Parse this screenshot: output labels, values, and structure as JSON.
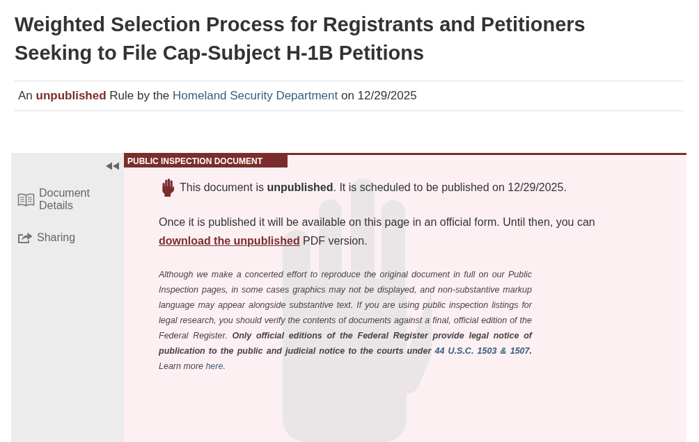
{
  "title": "Weighted Selection Process for Registrants and Petitioners Seeking to File Cap-Subject H-1B Petitions",
  "byline": {
    "before": "An **unpublished** Rule by the",
    "agency": "Homeland Security Department",
    "after": "on 12/29/2025"
  },
  "sidebar": {
    "items": [
      {
        "label": "Document Details"
      },
      {
        "label": "Sharing"
      }
    ]
  },
  "document": {
    "tab": "PUBLIC INSPECTION DOCUMENT",
    "notice": "This document is **unpublished**. It is scheduled to be published on 12/29/2025.",
    "availability": {
      "before": "Once it is published it will be available on this page in an official form. Until then, you can",
      "link": "download the unpublished",
      "after": "PDF version."
    },
    "disclaimer": [
      {
        "kind": "text",
        "text": "Although we make a concerted effort to reproduce the original document in full on our Public Inspection pages, in some cases graphics may not be displayed, and non-substantive markup language may appear alongside substantive text. If you are using public inspection listings for legal research, you should verify the contents of documents against a final, official edition of the Federal Register. **Only official editions of the Federal Register provide legal notice of publication to the public and judicial notice to the courts under** "
      },
      {
        "kind": "strong_link",
        "text": "44 U.S.C. 1503 & 1507"
      },
      {
        "kind": "text",
        "text": "**.** Learn more "
      },
      {
        "kind": "link",
        "text": "here"
      },
      {
        "kind": "text",
        "text": "."
      }
    ]
  }
}
